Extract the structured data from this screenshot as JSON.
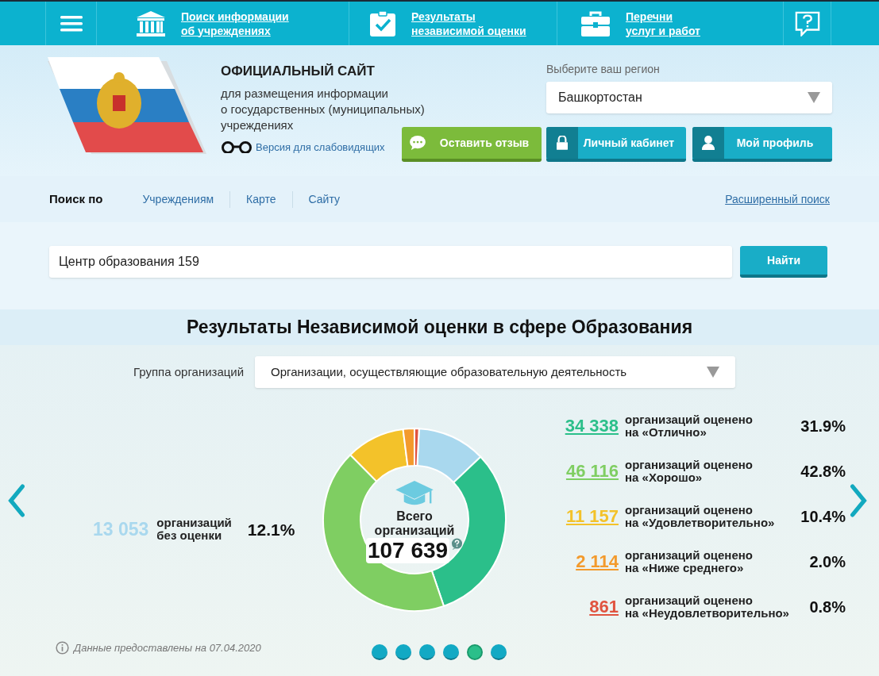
{
  "top_nav": {
    "links": [
      {
        "kind": "institutions",
        "label": "Поиск информации\nоб учреждениях"
      },
      {
        "kind": "results",
        "label": "Результаты\nнезависимой оценки"
      },
      {
        "kind": "services",
        "label": "Перечни\nуслуг и работ"
      }
    ]
  },
  "header": {
    "title": "ОФИЦИАЛЬНЫЙ САЙТ",
    "subtitle": "для размещения информации\nо государственных (муниципальных)\nучреждениях",
    "low_vision_link": "Версия для слабовидящих",
    "region": {
      "label": "Выберите ваш регион",
      "value": "Башкортостан"
    },
    "buttons": [
      {
        "kind": "feedback",
        "label": "Оставить отзыв"
      },
      {
        "kind": "cabinet",
        "label": "Личный кабинет"
      },
      {
        "kind": "profile",
        "label": "Мой профиль"
      }
    ]
  },
  "search": {
    "label": "Поиск по",
    "tabs": [
      "Учреждениям",
      "Карте",
      "Сайту"
    ],
    "advanced_link": "Расширенный поиск",
    "value": "Центр образования 159",
    "button": "Найти"
  },
  "results": {
    "title": "Результаты Независимой оценки в сфере Образования",
    "group_label": "Группа организаций",
    "group_value": "Организации, осуществляющие образовательную деятельность",
    "unrated": {
      "count": "13 053",
      "percent": "12.1%",
      "color": "#a9d8ee"
    },
    "ratings": [
      {
        "count": "34 338",
        "percent": "31.9%",
        "color": "#2bbf8a"
      },
      {
        "count": "46 116",
        "percent": "42.8%",
        "color": "#7fce62"
      },
      {
        "count": "11 157",
        "percent": "10.4%",
        "color": "#f3c22a"
      },
      {
        "count": "2 114",
        "percent": "2.0%",
        "color": "#f39a2c"
      },
      {
        "count": "861",
        "percent": "0.8%",
        "color": "#e0533f"
      }
    ],
    "total_label": "Всего\nорганизаций",
    "total": "107 639",
    "chart_data": {
      "type": "donut",
      "categories": [
        "организаций\nбез оценки",
        "организаций оценено\nна «Отлично»",
        "организаций оценено\nна «Хорошо»",
        "организаций оценено\nна «Удовлетворительно»",
        "организаций оценено\nна «Ниже среднего»",
        "организаций оценено\nна «Неудовлетворительно»"
      ],
      "values": [
        12.1,
        31.9,
        42.8,
        10.4,
        2.0,
        0.8
      ]
    },
    "note": "Данные предоставлены на 07.04.2020",
    "dots": [
      {
        "selected": false
      },
      {
        "selected": false
      },
      {
        "selected": false
      },
      {
        "selected": false
      },
      {
        "selected": true
      },
      {
        "selected": false
      }
    ]
  }
}
